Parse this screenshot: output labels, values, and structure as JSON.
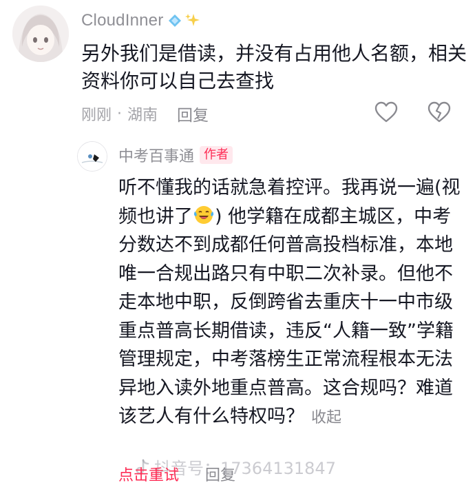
{
  "comment": {
    "username": "CloudInner",
    "badge_icons": [
      "diamond-icon",
      "sparkles-icon"
    ],
    "text": "另外我们是借读，并没有占用他人名额，相关资料你可以自己去查找",
    "time": "刚刚",
    "location": "湖南",
    "reply_label": "回复"
  },
  "reply": {
    "username": "中考百事通",
    "author_tag": "作者",
    "text_part1": "听不懂我的话就急着控评。我再说一遍(视频也讲了",
    "emoji": "laughing-crying-emoji",
    "text_part2": ") 他学籍在成都主城区，中考分数达不到成都任何普高投档标准，本地唯一合规出路只有中职二次补录。但他不走本地中职，反倒跨省去重庆十一中市级重点普高长期借读，违反“人籍一致”学籍管理规定，中考落榜生正常流程根本无法异地入读外地重点普高。这合规吗？难道该艺人有什么特权吗？",
    "collapse_label": "收起",
    "retry_label": "点击重试",
    "reply_label": "回复"
  },
  "watermark": {
    "text": "抖音号：17364131847"
  },
  "colors": {
    "accent": "#fe2c55",
    "text": "#161823",
    "meta": "#a3a3a8"
  }
}
